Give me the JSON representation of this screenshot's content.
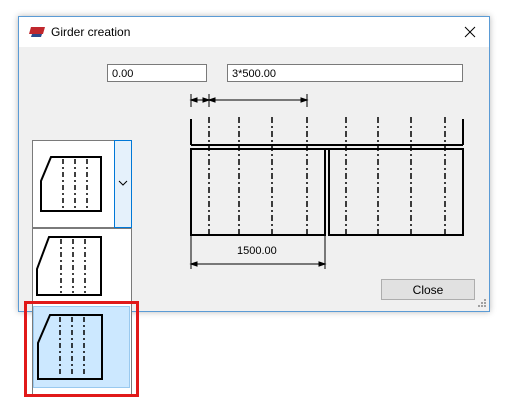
{
  "window": {
    "title": "Girder creation",
    "icon": "girder-app-icon",
    "close_icon": "close-icon"
  },
  "inputs": {
    "start_offset": "0.00",
    "spacing": "3*500.00"
  },
  "diagram": {
    "dimension_label": "1500.00"
  },
  "buttons": {
    "close_label": "Close"
  },
  "combo": {
    "selected_icon": "girder-profile-icon",
    "arrow_icon": "chevron-down-icon",
    "options": [
      {
        "icon": "girder-profile-icon-variant-1"
      },
      {
        "icon": "girder-profile-icon-variant-2"
      }
    ]
  },
  "colors": {
    "accent": "#0078d7",
    "highlight": "#e11919"
  }
}
